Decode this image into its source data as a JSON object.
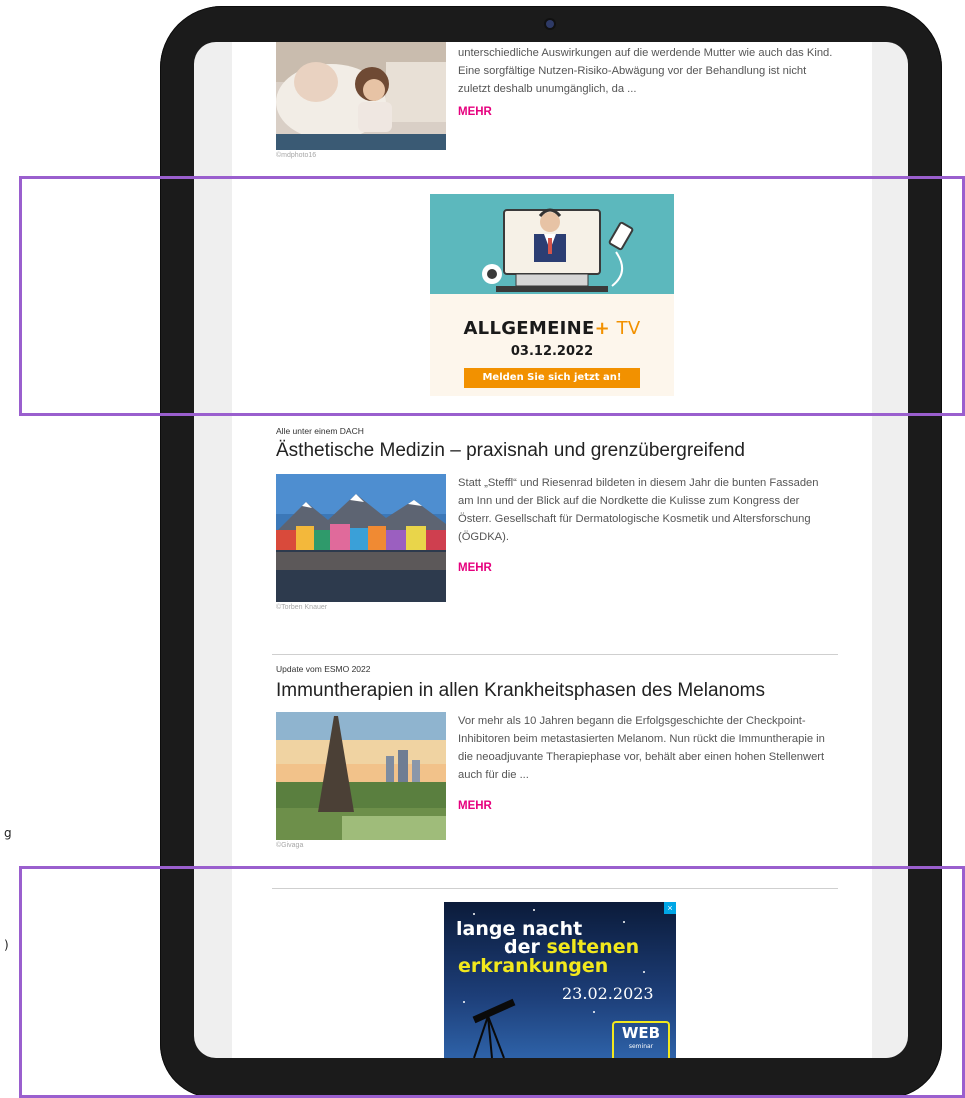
{
  "outer_fragments": [
    "g",
    ")"
  ],
  "article_top": {
    "excerpt": "unterschiedliche Auswirkungen auf die werdende Mutter wie auch das Kind. Eine sorgfältige Nutzen-Risiko-Abwägung vor der Behandlung ist nicht zuletzt deshalb unumgänglich, da ...",
    "more": "MEHR",
    "credit": "©mdphoto16"
  },
  "ad_allgemeine": {
    "brand": "ALLGEMEINE",
    "plus": "+",
    "suffix": "TV",
    "date": "03.12.2022",
    "cta": "Melden Sie sich jetzt an!"
  },
  "article_aesthetics": {
    "kicker": "Alle unter einem DACH",
    "title": "Ästhetische Medizin – praxisnah und grenzübergreifend",
    "excerpt": "Statt „Steffl“ und Riesenrad bildeten in diesem Jahr die bunten Fassaden am Inn und der Blick auf die Nordkette die Kulisse zum Kongress der Österr. Gesellschaft für Dermatologische Kosmetik und Altersforschung (ÖGDKA).",
    "more": "MEHR",
    "credit": "©Torben Knauer"
  },
  "article_melanoma": {
    "kicker": "Update vom ESMO 2022",
    "title": "Immuntherapien in allen Krankheitsphasen des Melanoms",
    "excerpt": "Vor mehr als 10 Jahren begann die Erfolgsgeschichte der Checkpoint-Inhibitoren beim metastasierten Melanom. Nun rückt die Immuntherapie in die neoadjuvante Therapiephase vor, behält aber einen hohen Stellenwert auch für die ...",
    "more": "MEHR",
    "credit": "©Givaga"
  },
  "ad_seltene": {
    "close": "×",
    "line1": "lange nacht",
    "line2a": "der ",
    "line2b": "seltenen",
    "line3": "erkrankungen",
    "date": "23.02.2023",
    "badge": "WEB",
    "badge_sub": "seminar"
  },
  "colors": {
    "accent": "#e6007e",
    "highlight": "#9a5fce",
    "ad_orange": "#f29100",
    "ad_yellow": "#f2e81d",
    "ad_teal": "#5cb8bd"
  }
}
